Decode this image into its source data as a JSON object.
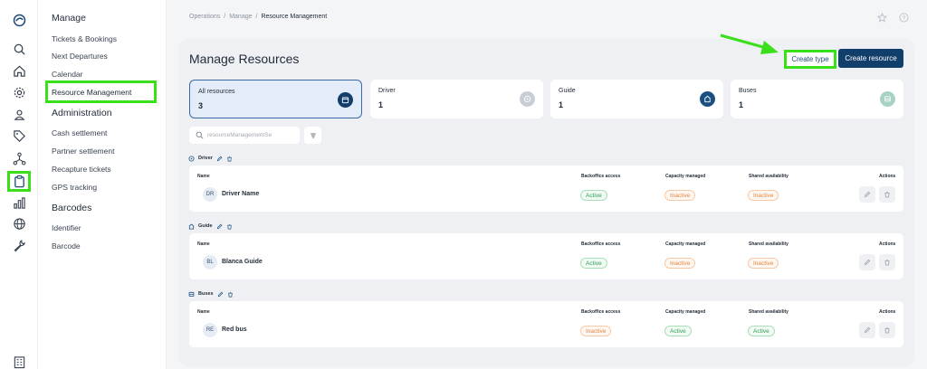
{
  "menu": {
    "manage_heading": "Manage",
    "manage_items": [
      "Tickets & Bookings",
      "Next Departures",
      "Calendar",
      "Resource Management"
    ],
    "admin_heading": "Administration",
    "admin_items": [
      "Cash settlement",
      "Partner settlement",
      "Recapture tickets",
      "GPS tracking"
    ],
    "barcodes_heading": "Barcodes",
    "barcodes_items": [
      "Identifier",
      "Barcode"
    ]
  },
  "breadcrumb": [
    "Operations",
    "Manage",
    "Resource Management"
  ],
  "page": {
    "title": "Manage Resources",
    "create_type_label": "Create type",
    "create_resource_label": "Create resource"
  },
  "cards": [
    {
      "label": "All resources",
      "value": "3"
    },
    {
      "label": "Driver",
      "value": "1"
    },
    {
      "label": "Guide",
      "value": "1"
    },
    {
      "label": "Buses",
      "value": "1"
    }
  ],
  "search": {
    "placeholder": "resourceManagementSe"
  },
  "columns": {
    "name": "Name",
    "backoffice": "Backoffice access",
    "capacity": "Capacity managed",
    "shared": "Shared availability",
    "actions": "Actions"
  },
  "sections": [
    {
      "title": "Driver",
      "row": {
        "initials": "DR",
        "name": "Driver Name",
        "backoffice": "Active",
        "capacity": "Inactive",
        "shared": "Inactive"
      }
    },
    {
      "title": "Guide",
      "row": {
        "initials": "BL",
        "name": "Blanca Guide",
        "backoffice": "Active",
        "capacity": "Inactive",
        "shared": "Inactive"
      }
    },
    {
      "title": "Buses",
      "row": {
        "initials": "RE",
        "name": "Red bus",
        "backoffice": "Inactive",
        "capacity": "Active",
        "shared": "Active"
      }
    }
  ],
  "colors": {
    "primary": "#123e6c",
    "highlight": "#39e01a",
    "active_badge": "#2f9e57",
    "inactive_badge": "#e08745"
  },
  "icons": [
    "logo-icon",
    "search-icon",
    "home-icon",
    "gear-icon",
    "user-pin-icon",
    "tag-icon",
    "network-icon",
    "clipboard-icon",
    "bar-chart-icon",
    "globe-icon",
    "wrench-icon",
    "building-icon",
    "star-icon",
    "help-icon",
    "pencil-icon",
    "trash-icon",
    "filter-icon"
  ]
}
